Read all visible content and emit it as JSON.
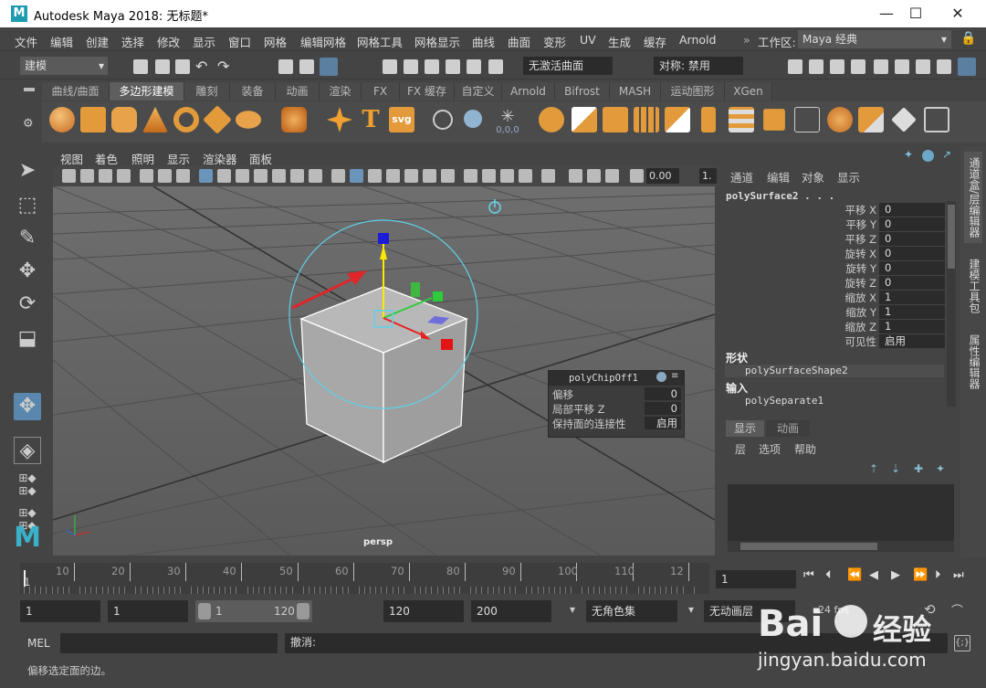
{
  "window": {
    "title": "Autodesk Maya 2018: 无标题*",
    "logo": "M",
    "min": "—",
    "max": "☐",
    "close": "✕"
  },
  "menu": [
    "文件",
    "编辑",
    "创建",
    "选择",
    "修改",
    "显示",
    "窗口",
    "网格",
    "编辑网格",
    "网格工具",
    "网格显示",
    "曲线",
    "曲面",
    "变形",
    "UV",
    "生成",
    "缓存",
    "Arnold"
  ],
  "workspace": {
    "label": "工作区:",
    "value": "Maya 经典"
  },
  "statusline": {
    "mode": "建模",
    "live_surface": "无激活曲面",
    "symmetry": "对称: 禁用"
  },
  "shelf_tabs": [
    "曲线/曲面",
    "多边形建模",
    "雕刻",
    "装备",
    "动画",
    "渲染",
    "FX",
    "FX 缓存",
    "自定义",
    "Arnold",
    "Bifrost",
    "MASH",
    "运动图形",
    "XGen"
  ],
  "shelf_active": "多边形建模",
  "shelf_icons": [
    "sphere-icon",
    "cube-icon",
    "cylinder-icon",
    "cone-icon",
    "torus-icon",
    "plane-icon",
    "disc-icon",
    "platonic-icon",
    "superellipse-icon",
    "type-icon",
    "svg-icon",
    "smooth-icon",
    "combine-icon",
    "separate-icon",
    "bevel-icon",
    "extrude-icon",
    "bridge-icon",
    "multicut-icon",
    "merge-icon",
    "center-pivot-icon",
    "fill-hole-icon",
    "triangulate-icon",
    "quadrangulate-icon",
    "mirror-icon",
    "boolean-icon",
    "reduce-icon",
    "retopo-icon"
  ],
  "shelf_text": {
    "type_glyph": "T",
    "svg_glyph": "svg",
    "coords_glyph": "0,0,0"
  },
  "panel_menu": [
    "视图",
    "着色",
    "照明",
    "显示",
    "渲染器",
    "面板"
  ],
  "panel_toolbar": {
    "exposure": "0.00",
    "gamma": "1."
  },
  "viewport": {
    "camera_label": "persp"
  },
  "chip_off": {
    "title": "polyChipOff1",
    "rows": [
      {
        "label": "偏移",
        "value": "0"
      },
      {
        "label": "局部平移 Z",
        "value": "0"
      },
      {
        "label": "保持面的连接性",
        "value": "启用"
      }
    ]
  },
  "channel_box": {
    "menus": [
      "通道",
      "编辑",
      "对象",
      "显示"
    ],
    "object": "polySurface2 . . .",
    "attributes": [
      {
        "name": "平移 X",
        "value": "0"
      },
      {
        "name": "平移 Y",
        "value": "0"
      },
      {
        "name": "平移 Z",
        "value": "0"
      },
      {
        "name": "旋转 X",
        "value": "0"
      },
      {
        "name": "旋转 Y",
        "value": "0"
      },
      {
        "name": "旋转 Z",
        "value": "0"
      },
      {
        "name": "缩放 X",
        "value": "1"
      },
      {
        "name": "缩放 Y",
        "value": "1"
      },
      {
        "name": "缩放 Z",
        "value": "1"
      },
      {
        "name": "可见性",
        "value": "启用"
      }
    ],
    "shapes_header": "形状",
    "shape": "polySurfaceShape2",
    "inputs_header": "输入",
    "input": "polySeparate1"
  },
  "layer_editor": {
    "tabs": [
      "显示",
      "动画"
    ],
    "menus": [
      "层",
      "选项",
      "帮助"
    ]
  },
  "side_tabs": [
    "通道盒/层编辑器",
    "建模工具包",
    "属性编辑器"
  ],
  "timeslider": {
    "ticks": [
      "10",
      "20",
      "30",
      "40",
      "50",
      "60",
      "70",
      "80",
      "90",
      "100",
      "110",
      "12"
    ],
    "start_label": "1",
    "current_frame": "1"
  },
  "range": {
    "start": "1",
    "anim_start": "1",
    "range_start": "1",
    "range_end": "120",
    "anim_end": "120",
    "end": "200",
    "char_set": "无角色集",
    "anim_layer": "无动画层",
    "fps": "24 fps"
  },
  "command": {
    "lang": "MEL",
    "result": "撤消:"
  },
  "help_line": "偏移选定面的边。",
  "watermark": {
    "brand": "Bai",
    "brand2": "经验",
    "url": "jingyan.baidu.com"
  }
}
